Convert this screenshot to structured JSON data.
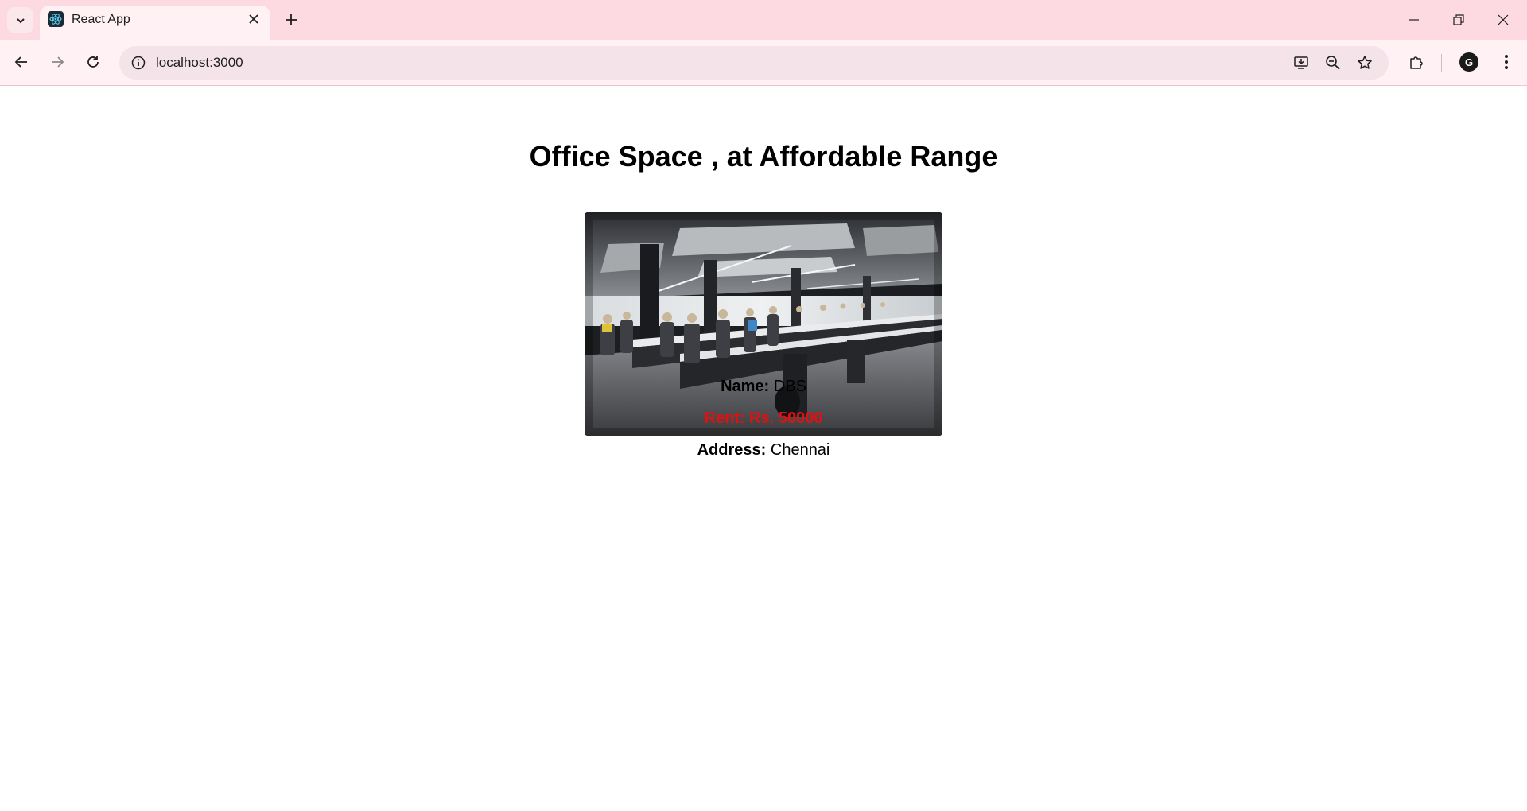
{
  "browser": {
    "tab_title": "React App",
    "url": "localhost:3000",
    "profile_initial": "G"
  },
  "colors": {
    "tabstrip_bg": "#fdd9e1",
    "toolbar_bg": "#fff1f4",
    "rent_color": "#e31010"
  },
  "page": {
    "title": "Office Space , at Affordable Range",
    "image_alt": "office-photo",
    "name_label": "Name:",
    "name_value": "DBS",
    "rent_label": "Rent: Rs.",
    "rent_value": "50000",
    "address_label": "Address:",
    "address_value": "Chennai"
  }
}
